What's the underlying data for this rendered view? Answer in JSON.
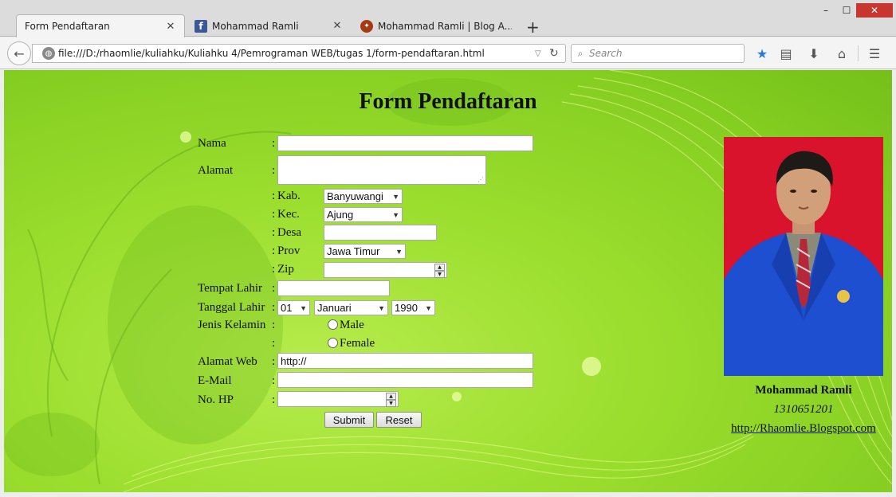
{
  "browser": {
    "tabs": [
      {
        "title": "Form Pendaftaran"
      },
      {
        "title": "Mohammad Ramli"
      },
      {
        "title": "Mohammad Ramli | Blog A..."
      }
    ],
    "url": "file:///D:/rhaomlie/kuliahku/Kuliahku 4/Pemrograman WEB/tugas 1/form-pendaftaran.html",
    "search_placeholder": "Search"
  },
  "form": {
    "title": "Form Pendaftaran",
    "labels": {
      "nama": "Nama",
      "alamat": "Alamat",
      "kab": "Kab.",
      "kec": "Kec.",
      "desa": "Desa",
      "prov": "Prov",
      "zip": "Zip",
      "tempat_lahir": "Tempat Lahir",
      "tanggal_lahir": "Tanggal Lahir",
      "jenis_kelamin": "Jenis Kelamin",
      "male": "Male",
      "female": "Female",
      "alamat_web": "Alamat Web",
      "email": "E-Mail",
      "no_hp": "No. HP"
    },
    "colon": ":",
    "values": {
      "kab": "Banyuwangi",
      "kec": "Ajung",
      "prov": "Jawa Timur",
      "tgl_day": "01",
      "tgl_month": "Januari",
      "tgl_year": "1990",
      "alamat_web": "http://"
    },
    "buttons": {
      "submit": "Submit",
      "reset": "Reset"
    }
  },
  "profile": {
    "name": "Mohammad Ramli",
    "nim": "1310651201",
    "link": "http://Rhaomlie.Blogspot.com"
  }
}
